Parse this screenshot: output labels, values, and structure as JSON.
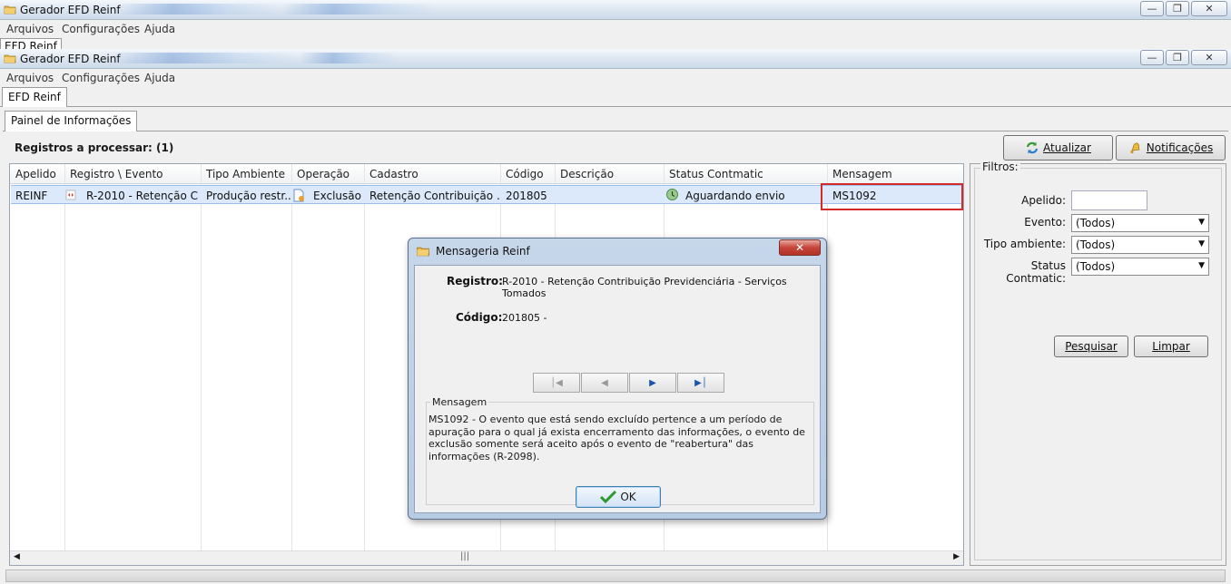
{
  "outer_window": {
    "title": "Gerador EFD Reinf",
    "menu": [
      "Arquivos",
      "Configurações",
      "Ajuda"
    ],
    "tab": "EFD Reinf"
  },
  "inner_window": {
    "title": "Gerador EFD Reinf",
    "menu": [
      "Arquivos",
      "Configurações",
      "Ajuda"
    ],
    "tab": "EFD Reinf"
  },
  "panel": {
    "tab": "Painel de Informações",
    "records_title": "Registros a processar: (1)",
    "btn_update": "Atualizar",
    "btn_notifications": "Notificações"
  },
  "table": {
    "columns": [
      "Apelido",
      "Registro \\ Evento",
      "Tipo Ambiente",
      "Operação",
      "Cadastro",
      "Código",
      "Descrição",
      "Status Contmatic",
      "Mensagem"
    ],
    "rows": [
      {
        "apelido": "REINF",
        "registro": "R-2010 - Retenção C...",
        "tipo_ambiente": "Produção restr...",
        "operacao": "Exclusão",
        "cadastro": "Retenção Contribuição ...",
        "codigo": "201805",
        "descricao": "",
        "status": "Aguardando envio",
        "mensagem": "MS1092"
      }
    ],
    "highlight_color": "#d42a2a"
  },
  "filters": {
    "title": "Filtros:",
    "apelido_label": "Apelido:",
    "apelido_value": "",
    "evento_label": "Evento:",
    "evento_value": "(Todos)",
    "tipo_label": "Tipo ambiente:",
    "tipo_value": "(Todos)",
    "status_label": "Status Contmatic:",
    "status_value": "(Todos)",
    "btn_search": "Pesquisar",
    "btn_clear": "Limpar"
  },
  "dialog": {
    "title": "Mensageria Reinf",
    "registro_label": "Registro:",
    "registro_value": "R-2010 - Retenção Contribuição Previdenciária - Serviços Tomados",
    "codigo_label": "Código:",
    "codigo_value": "201805 -",
    "message_legend": "Mensagem",
    "message_text": "MS1092 - O evento que está sendo excluído pertence a um período de apuração para o qual já exista encerramento das informações, o evento de exclusão somente será aceito após o evento de \"reabertura\" das informações (R-2098).",
    "ok_label": "OK"
  },
  "icons": {
    "app": "folder-icon",
    "refresh": "refresh-icon",
    "notifications": "bell-icon",
    "event": "event-icon",
    "operation": "document-delete-icon",
    "status": "clock-icon",
    "ok": "checkmark-icon"
  }
}
